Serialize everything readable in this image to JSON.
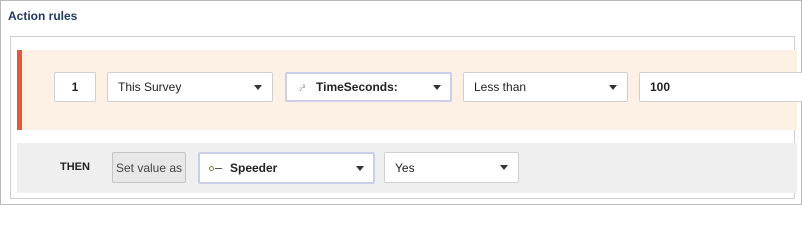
{
  "section_title": "Action rules",
  "condition": {
    "index": "1",
    "source": "This Survey",
    "field": "TimeSeconds:",
    "field_type_icon": "numeric-type-icon",
    "operator": "Less than",
    "value": "100"
  },
  "action": {
    "then_label": "THEN",
    "set_button": "Set value as",
    "variable": "Speeder",
    "variable_icon": "variable-icon",
    "value": "Yes"
  },
  "colors": {
    "condition_accent": "#e25a3c",
    "condition_bg": "#fdf1e6",
    "action_bg": "#efefef",
    "title": "#1f3b63"
  }
}
